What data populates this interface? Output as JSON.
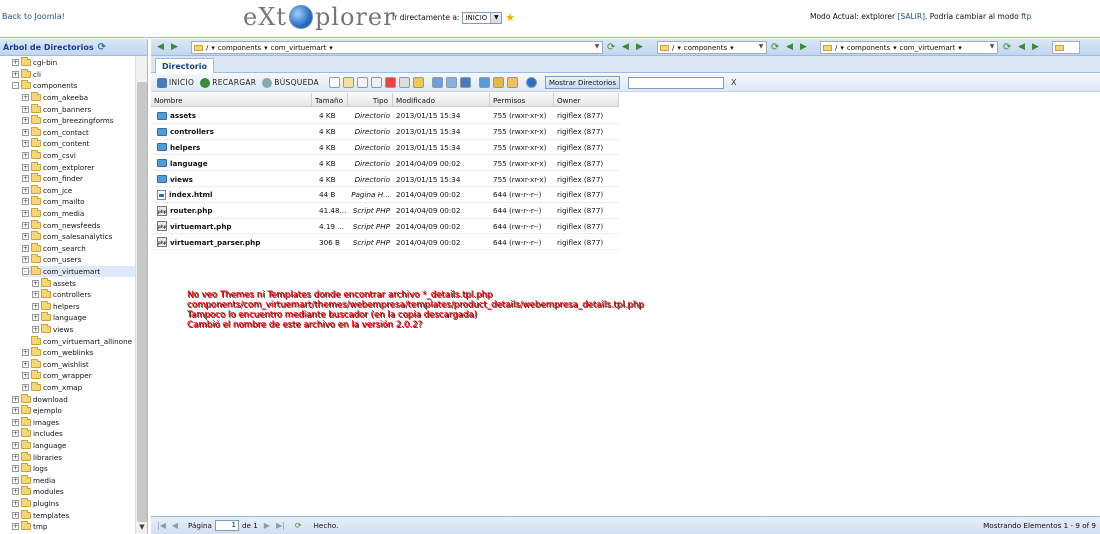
{
  "header": {
    "back_link": "Back to Joomla!",
    "logo_left": "eXt",
    "logo_right": "plorer",
    "goto_label": "Ir directamente a:",
    "goto_value": "INICIO",
    "mode_prefix": "Modo Actual: extplorer",
    "logout": "[SALIR]",
    "mode_middle": ". Podría cambiar al modo",
    "ftp": "ftp"
  },
  "tree": {
    "title": "Árbol de Directorios",
    "nodes": [
      {
        "label": "cgi-bin",
        "level": 0,
        "expander": "+"
      },
      {
        "label": "cli",
        "level": 0,
        "expander": "+"
      },
      {
        "label": "components",
        "level": 0,
        "expander": "-",
        "open": true
      },
      {
        "label": "com_akeeba",
        "level": 1,
        "expander": "+"
      },
      {
        "label": "com_banners",
        "level": 1,
        "expander": "+"
      },
      {
        "label": "com_breezingforms",
        "level": 1,
        "expander": "+"
      },
      {
        "label": "com_contact",
        "level": 1,
        "expander": "+"
      },
      {
        "label": "com_content",
        "level": 1,
        "expander": "+"
      },
      {
        "label": "com_csvi",
        "level": 1,
        "expander": "+"
      },
      {
        "label": "com_extplorer",
        "level": 1,
        "expander": "+"
      },
      {
        "label": "com_finder",
        "level": 1,
        "expander": "+"
      },
      {
        "label": "com_jce",
        "level": 1,
        "expander": "+"
      },
      {
        "label": "com_mailto",
        "level": 1,
        "expander": "+"
      },
      {
        "label": "com_media",
        "level": 1,
        "expander": "+"
      },
      {
        "label": "com_newsfeeds",
        "level": 1,
        "expander": "+"
      },
      {
        "label": "com_salesanalytics",
        "level": 1,
        "expander": "+"
      },
      {
        "label": "com_search",
        "level": 1,
        "expander": "+"
      },
      {
        "label": "com_users",
        "level": 1,
        "expander": "+"
      },
      {
        "label": "com_virtuemart",
        "level": 1,
        "expander": "-",
        "open": true,
        "selected": true
      },
      {
        "label": "assets",
        "level": 2,
        "expander": "+"
      },
      {
        "label": "controllers",
        "level": 2,
        "expander": "+"
      },
      {
        "label": "helpers",
        "level": 2,
        "expander": "+"
      },
      {
        "label": "language",
        "level": 2,
        "expander": "+"
      },
      {
        "label": "views",
        "level": 2,
        "expander": "+"
      },
      {
        "label": "com_virtuemart_allinone",
        "level": 1,
        "expander": ""
      },
      {
        "label": "com_weblinks",
        "level": 1,
        "expander": "+"
      },
      {
        "label": "com_wishlist",
        "level": 1,
        "expander": "+"
      },
      {
        "label": "com_wrapper",
        "level": 1,
        "expander": "+"
      },
      {
        "label": "com_xmap",
        "level": 1,
        "expander": "+"
      },
      {
        "label": "download",
        "level": 0,
        "expander": "+"
      },
      {
        "label": "ejemplo",
        "level": 0,
        "expander": "+"
      },
      {
        "label": "images",
        "level": 0,
        "expander": "+"
      },
      {
        "label": "includes",
        "level": 0,
        "expander": "+"
      },
      {
        "label": "language",
        "level": 0,
        "expander": "+"
      },
      {
        "label": "libraries",
        "level": 0,
        "expander": "+"
      },
      {
        "label": "logs",
        "level": 0,
        "expander": "+"
      },
      {
        "label": "media",
        "level": 0,
        "expander": "+"
      },
      {
        "label": "modules",
        "level": 0,
        "expander": "+"
      },
      {
        "label": "plugins",
        "level": 0,
        "expander": "+"
      },
      {
        "label": "templates",
        "level": 0,
        "expander": "+"
      },
      {
        "label": "tmp",
        "level": 0,
        "expander": "+"
      }
    ]
  },
  "paths": [
    {
      "segments": [
        "/",
        "components",
        "com_virtuemart"
      ]
    },
    {
      "segments": [
        "/",
        "components"
      ]
    },
    {
      "segments": [
        "/",
        "components",
        "com_virtuemart"
      ]
    }
  ],
  "tab": {
    "label": "Directorio"
  },
  "toolbar": {
    "inicio": "INICIO",
    "recargar": "RECARGAR",
    "busqueda": "BÚSQUEDA",
    "show_dirs": "Mostrar Directorios",
    "clear": "X"
  },
  "grid": {
    "columns": [
      "Nombre",
      "Tamaño",
      "Tipo",
      "Modificado",
      "Permisos",
      "Owner"
    ],
    "rows": [
      {
        "icon": "dir",
        "name": "assets",
        "size": "4 KB",
        "type": "Directorio",
        "modified": "2013/01/15 15:34",
        "perms": "755 (rwxr-xr-x)",
        "owner": "rigiflex (877)"
      },
      {
        "icon": "dir",
        "name": "controllers",
        "size": "4 KB",
        "type": "Directorio",
        "modified": "2013/01/15 15:34",
        "perms": "755 (rwxr-xr-x)",
        "owner": "rigiflex (877)"
      },
      {
        "icon": "dir",
        "name": "helpers",
        "size": "4 KB",
        "type": "Directorio",
        "modified": "2013/01/15 15:34",
        "perms": "755 (rwxr-xr-x)",
        "owner": "rigiflex (877)"
      },
      {
        "icon": "dir",
        "name": "language",
        "size": "4 KB",
        "type": "Directorio",
        "modified": "2014/04/09 00:02",
        "perms": "755 (rwxr-xr-x)",
        "owner": "rigiflex (877)"
      },
      {
        "icon": "dir",
        "name": "views",
        "size": "4 KB",
        "type": "Directorio",
        "modified": "2013/01/15 15:34",
        "perms": "755 (rwxr-xr-x)",
        "owner": "rigiflex (877)"
      },
      {
        "icon": "html",
        "name": "index.html",
        "size": "44 B",
        "type": "Pagina H...",
        "modified": "2014/04/09 00:02",
        "perms": "644 (rw-r--r--)",
        "owner": "rigiflex (877)"
      },
      {
        "icon": "php",
        "name": "router.php",
        "size": "41.48...",
        "type": "Script PHP",
        "modified": "2014/04/09 00:02",
        "perms": "644 (rw-r--r--)",
        "owner": "rigiflex (877)"
      },
      {
        "icon": "php",
        "name": "virtuemart.php",
        "size": "4.19 ...",
        "type": "Script PHP",
        "modified": "2014/04/09 00:02",
        "perms": "644 (rw-r--r--)",
        "owner": "rigiflex (877)"
      },
      {
        "icon": "php",
        "name": "virtuemart_parser.php",
        "size": "306 B",
        "type": "Script PHP",
        "modified": "2014/04/09 00:02",
        "perms": "644 (rw-r--r--)",
        "owner": "rigiflex (877)"
      }
    ]
  },
  "note": {
    "lines": [
      "No veo Themes ni Templates donde encontrar archivo *_details.tpl.php",
      "components/com_virtuemart/themes/webempresa/templates/product_details/webempresa_details.tpl.php",
      "Tampoco lo encuentro mediante buscador (en la copia descargada)",
      "Cambió el nombre de este archivo en la versión 2.0.2?"
    ]
  },
  "status": {
    "page_label": "Página",
    "page_value": "1",
    "of_label": "de 1",
    "done": "Hecho.",
    "summary": "Mostrando Elementos 1 - 9 of 9"
  }
}
